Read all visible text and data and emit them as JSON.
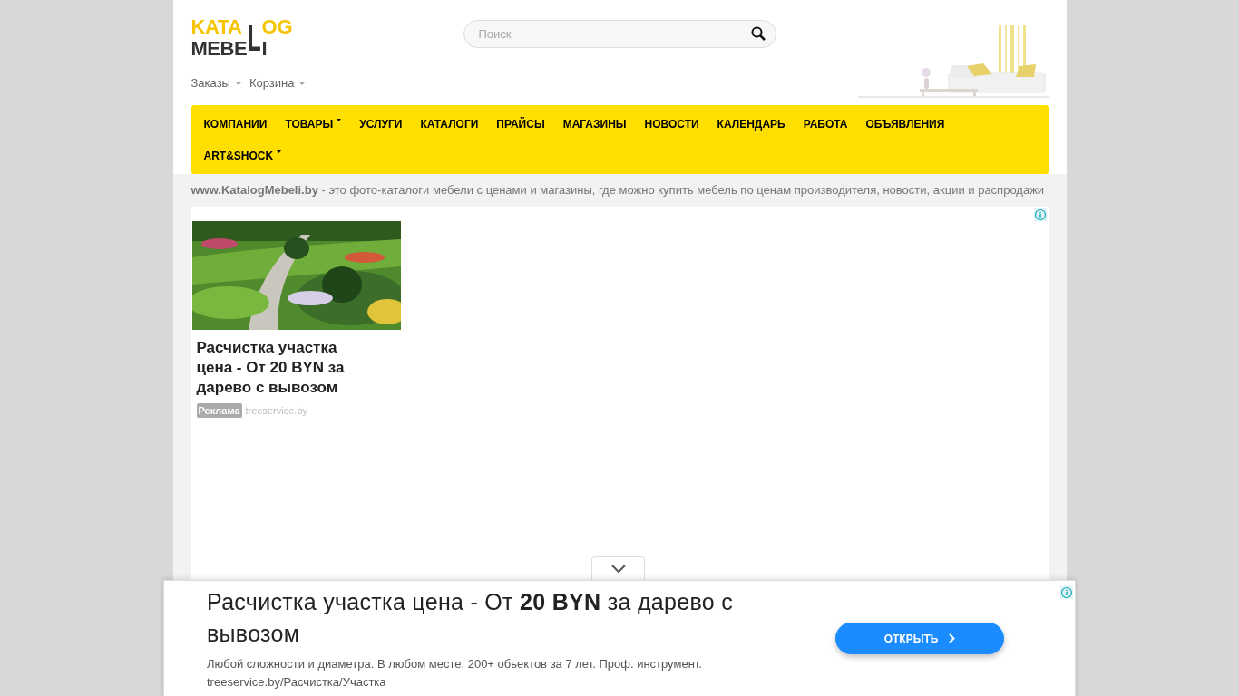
{
  "logo": {
    "top": "KATA",
    "stem": "L",
    "top_end": "OG",
    "bottom": "MEBE",
    "bottom_end": "I"
  },
  "search": {
    "placeholder": "Поиск"
  },
  "user_links": [
    {
      "label": "Заказы",
      "dropdown": true
    },
    {
      "label": "Корзина",
      "dropdown": true
    }
  ],
  "nav": [
    {
      "label": "КОМПАНИИ",
      "dropdown": false
    },
    {
      "label": "ТОВАРЫ",
      "dropdown": true
    },
    {
      "label": "УСЛУГИ",
      "dropdown": false
    },
    {
      "label": "КАТАЛОГИ",
      "dropdown": false
    },
    {
      "label": "ПРАЙСЫ",
      "dropdown": false
    },
    {
      "label": "МАГАЗИНЫ",
      "dropdown": false
    },
    {
      "label": "НОВОСТИ",
      "dropdown": false
    },
    {
      "label": "КАЛЕНДАРЬ",
      "dropdown": false
    },
    {
      "label": "РАБОТА",
      "dropdown": false
    },
    {
      "label": "ОБЪЯВЛЕНИЯ",
      "dropdown": false
    },
    {
      "label": "ART&SHOCK",
      "dropdown": true
    }
  ],
  "tagline": "**www.KatalogMebeli.by** - это фото-каталоги мебели с ценами и магазины, где можно купить мебель по ценам производителя, новости, акции и распродажи",
  "ad_card": {
    "title": "Расчистка участка цена - От 20 BYN за дарево с вывозом",
    "badge": "Реклама",
    "domain": "treeservice.by"
  },
  "bottom_ad": {
    "title": "Расчистка участка цена - От **20 BYN** за дарево с вывозом",
    "description": "Любой сложности и диаметра. В любом месте. 200+ обьектов за 7 лет. Проф. инструмент.",
    "url": "treeservice.by/Расчистка/Участка",
    "button": "ОТКРЫТЬ"
  }
}
